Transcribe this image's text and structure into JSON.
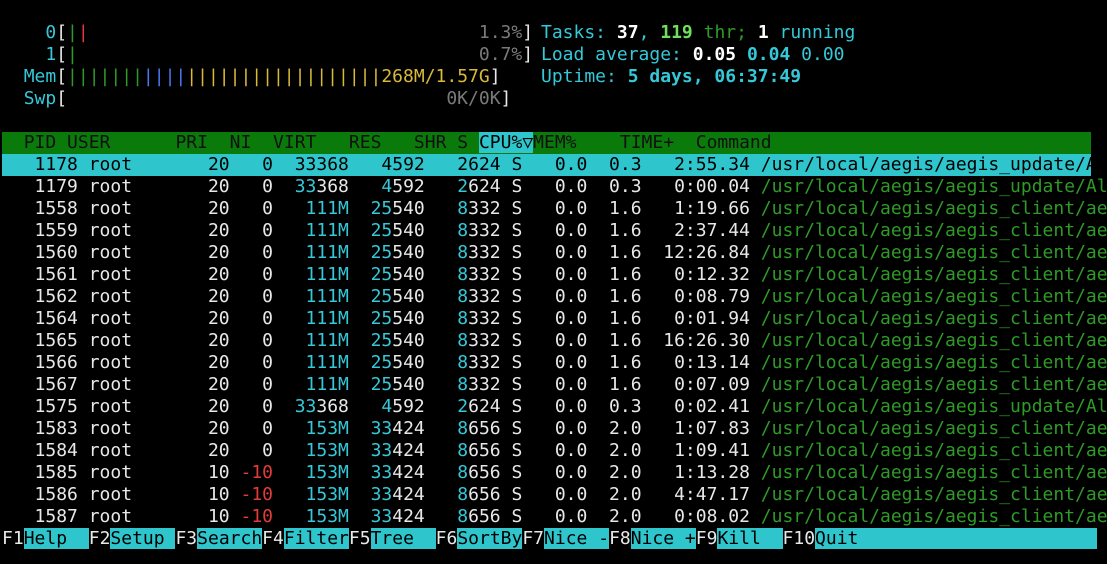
{
  "meters": {
    "cpu0": {
      "label": "0",
      "value": "1.3%"
    },
    "cpu1": {
      "label": "1",
      "value": "0.7%"
    },
    "mem": {
      "label": "Mem",
      "value": "268M/1.57G"
    },
    "swp": {
      "label": "Swp",
      "value": "0K/0K"
    }
  },
  "summary": {
    "tasks_label": "Tasks:",
    "tasks": "37",
    "threads": "119",
    "threads_label": "thr;",
    "running": "1",
    "running_label": "running",
    "load_label": "Load average:",
    "load1": "0.05",
    "load5": "0.04",
    "load15": "0.00",
    "uptime_label": "Uptime:",
    "uptime": "5 days, 06:37:49"
  },
  "columns": [
    "PID",
    "USER",
    "PRI",
    "NI",
    "VIRT",
    "RES",
    "SHR",
    "S",
    "CPU%▽",
    "MEM%",
    "TIME+",
    "Command"
  ],
  "processes": [
    {
      "pid": "1178",
      "user": "root",
      "pri": "20",
      "ni": "0",
      "virt": "33368",
      "res": "4592",
      "shr": "2624",
      "s": "S",
      "cpu": "0.0",
      "mem": "0.3",
      "time": "2:55.34",
      "cmd": "/usr/local/aegis/aegis_update/AliY"
    },
    {
      "pid": "1179",
      "user": "root",
      "pri": "20",
      "ni": "0",
      "virt": "33368",
      "res": "4592",
      "shr": "2624",
      "s": "S",
      "cpu": "0.0",
      "mem": "0.3",
      "time": "0:00.04",
      "cmd": "/usr/local/aegis/aegis_update/AliY"
    },
    {
      "pid": "1558",
      "user": "root",
      "pri": "20",
      "ni": "0",
      "virt": "111M",
      "res": "25540",
      "shr": "8332",
      "s": "S",
      "cpu": "0.0",
      "mem": "1.6",
      "time": "1:19.66",
      "cmd": "/usr/local/aegis/aegis_client/aegi"
    },
    {
      "pid": "1559",
      "user": "root",
      "pri": "20",
      "ni": "0",
      "virt": "111M",
      "res": "25540",
      "shr": "8332",
      "s": "S",
      "cpu": "0.0",
      "mem": "1.6",
      "time": "2:37.44",
      "cmd": "/usr/local/aegis/aegis_client/aegi"
    },
    {
      "pid": "1560",
      "user": "root",
      "pri": "20",
      "ni": "0",
      "virt": "111M",
      "res": "25540",
      "shr": "8332",
      "s": "S",
      "cpu": "0.0",
      "mem": "1.6",
      "time": "12:26.84",
      "cmd": "/usr/local/aegis/aegis_client/aegi"
    },
    {
      "pid": "1561",
      "user": "root",
      "pri": "20",
      "ni": "0",
      "virt": "111M",
      "res": "25540",
      "shr": "8332",
      "s": "S",
      "cpu": "0.0",
      "mem": "1.6",
      "time": "0:12.32",
      "cmd": "/usr/local/aegis/aegis_client/aegi"
    },
    {
      "pid": "1562",
      "user": "root",
      "pri": "20",
      "ni": "0",
      "virt": "111M",
      "res": "25540",
      "shr": "8332",
      "s": "S",
      "cpu": "0.0",
      "mem": "1.6",
      "time": "0:08.79",
      "cmd": "/usr/local/aegis/aegis_client/aegi"
    },
    {
      "pid": "1564",
      "user": "root",
      "pri": "20",
      "ni": "0",
      "virt": "111M",
      "res": "25540",
      "shr": "8332",
      "s": "S",
      "cpu": "0.0",
      "mem": "1.6",
      "time": "0:01.94",
      "cmd": "/usr/local/aegis/aegis_client/aegi"
    },
    {
      "pid": "1565",
      "user": "root",
      "pri": "20",
      "ni": "0",
      "virt": "111M",
      "res": "25540",
      "shr": "8332",
      "s": "S",
      "cpu": "0.0",
      "mem": "1.6",
      "time": "16:26.30",
      "cmd": "/usr/local/aegis/aegis_client/aegi"
    },
    {
      "pid": "1566",
      "user": "root",
      "pri": "20",
      "ni": "0",
      "virt": "111M",
      "res": "25540",
      "shr": "8332",
      "s": "S",
      "cpu": "0.0",
      "mem": "1.6",
      "time": "0:13.14",
      "cmd": "/usr/local/aegis/aegis_client/aegi"
    },
    {
      "pid": "1567",
      "user": "root",
      "pri": "20",
      "ni": "0",
      "virt": "111M",
      "res": "25540",
      "shr": "8332",
      "s": "S",
      "cpu": "0.0",
      "mem": "1.6",
      "time": "0:07.09",
      "cmd": "/usr/local/aegis/aegis_client/aegi"
    },
    {
      "pid": "1575",
      "user": "root",
      "pri": "20",
      "ni": "0",
      "virt": "33368",
      "res": "4592",
      "shr": "2624",
      "s": "S",
      "cpu": "0.0",
      "mem": "0.3",
      "time": "0:02.41",
      "cmd": "/usr/local/aegis/aegis_update/AliY"
    },
    {
      "pid": "1583",
      "user": "root",
      "pri": "20",
      "ni": "0",
      "virt": "153M",
      "res": "33424",
      "shr": "8656",
      "s": "S",
      "cpu": "0.0",
      "mem": "2.0",
      "time": "1:07.83",
      "cmd": "/usr/local/aegis/aegis_client/aegi"
    },
    {
      "pid": "1584",
      "user": "root",
      "pri": "20",
      "ni": "0",
      "virt": "153M",
      "res": "33424",
      "shr": "8656",
      "s": "S",
      "cpu": "0.0",
      "mem": "2.0",
      "time": "1:09.41",
      "cmd": "/usr/local/aegis/aegis_client/aegi"
    },
    {
      "pid": "1585",
      "user": "root",
      "pri": "10",
      "ni": "-10",
      "virt": "153M",
      "res": "33424",
      "shr": "8656",
      "s": "S",
      "cpu": "0.0",
      "mem": "2.0",
      "time": "1:13.28",
      "cmd": "/usr/local/aegis/aegis_client/aegi"
    },
    {
      "pid": "1586",
      "user": "root",
      "pri": "10",
      "ni": "-10",
      "virt": "153M",
      "res": "33424",
      "shr": "8656",
      "s": "S",
      "cpu": "0.0",
      "mem": "2.0",
      "time": "4:47.17",
      "cmd": "/usr/local/aegis/aegis_client/aegi"
    },
    {
      "pid": "1587",
      "user": "root",
      "pri": "10",
      "ni": "-10",
      "virt": "153M",
      "res": "33424",
      "shr": "8656",
      "s": "S",
      "cpu": "0.0",
      "mem": "2.0",
      "time": "0:08.02",
      "cmd": "/usr/local/aegis/aegis_client/aegi"
    }
  ],
  "function_keys": [
    {
      "key": "F1",
      "label": "Help"
    },
    {
      "key": "F2",
      "label": "Setup"
    },
    {
      "key": "F3",
      "label": "Search"
    },
    {
      "key": "F4",
      "label": "Filter"
    },
    {
      "key": "F5",
      "label": "Tree"
    },
    {
      "key": "F6",
      "label": "SortBy"
    },
    {
      "key": "F7",
      "label": "Nice -"
    },
    {
      "key": "F8",
      "label": "Nice +"
    },
    {
      "key": "F9",
      "label": "Kill"
    },
    {
      "key": "F10",
      "label": "Quit"
    }
  ],
  "colors": {
    "header_bg": "#0a7a0a",
    "selection_bg": "#2ec6cc",
    "accent_cyan": "#35c8d8",
    "green": "#2f9a28"
  }
}
